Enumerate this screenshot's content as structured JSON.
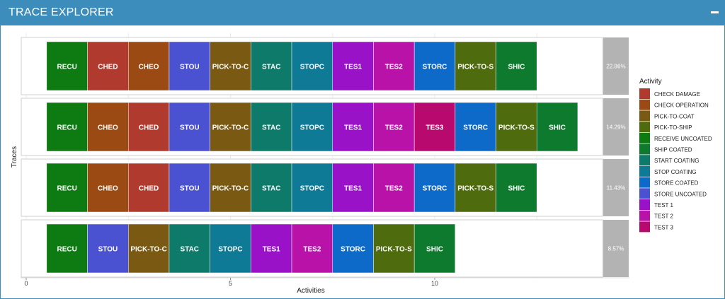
{
  "header": {
    "title": "TRACE EXPLORER",
    "collapse_icon": "minus-icon"
  },
  "chart_data": {
    "type": "trace-explorer",
    "xlabel": "Activities",
    "ylabel": "Traces",
    "x_ticks": [
      0,
      5,
      10
    ],
    "xlim": [
      0,
      14.5
    ],
    "legend_title": "Activity",
    "legend_position": "right",
    "activities": [
      {
        "name": "CHECK DAMAGE",
        "color": "#b03a2e"
      },
      {
        "name": "CHECK OPERATION",
        "color": "#9a4a12"
      },
      {
        "name": "PICK-TO-COAT",
        "color": "#7a5a12"
      },
      {
        "name": "PICK-TO-SHIP",
        "color": "#4e6c0e"
      },
      {
        "name": "RECEIVE UNCOATED",
        "color": "#0e7a12"
      },
      {
        "name": "SHIP COATED",
        "color": "#0e7a2e"
      },
      {
        "name": "START COATING",
        "color": "#0e7a6a"
      },
      {
        "name": "STOP COATING",
        "color": "#0e7a96"
      },
      {
        "name": "STORE COATED",
        "color": "#0e6ac8"
      },
      {
        "name": "STORE UNCOATED",
        "color": "#4a52d2"
      },
      {
        "name": "TEST 1",
        "color": "#9a12c8"
      },
      {
        "name": "TEST 2",
        "color": "#b812a8"
      },
      {
        "name": "TEST 3",
        "color": "#b80a6e"
      }
    ],
    "traces": [
      {
        "percent": "22.86%",
        "segments": [
          {
            "label": "RECU",
            "activity": "RECEIVE UNCOATED"
          },
          {
            "label": "CHED",
            "activity": "CHECK DAMAGE"
          },
          {
            "label": "CHEO",
            "activity": "CHECK OPERATION"
          },
          {
            "label": "STOU",
            "activity": "STORE UNCOATED"
          },
          {
            "label": "PICK-TO-C",
            "activity": "PICK-TO-COAT"
          },
          {
            "label": "STAC",
            "activity": "START COATING"
          },
          {
            "label": "STOPC",
            "activity": "STOP COATING"
          },
          {
            "label": "TES1",
            "activity": "TEST 1"
          },
          {
            "label": "TES2",
            "activity": "TEST 2"
          },
          {
            "label": "STORC",
            "activity": "STORE COATED"
          },
          {
            "label": "PICK-TO-S",
            "activity": "PICK-TO-SHIP"
          },
          {
            "label": "SHIC",
            "activity": "SHIP COATED"
          }
        ]
      },
      {
        "percent": "14.29%",
        "segments": [
          {
            "label": "RECU",
            "activity": "RECEIVE UNCOATED"
          },
          {
            "label": "CHEO",
            "activity": "CHECK OPERATION"
          },
          {
            "label": "CHED",
            "activity": "CHECK DAMAGE"
          },
          {
            "label": "STOU",
            "activity": "STORE UNCOATED"
          },
          {
            "label": "PICK-TO-C",
            "activity": "PICK-TO-COAT"
          },
          {
            "label": "STAC",
            "activity": "START COATING"
          },
          {
            "label": "STOPC",
            "activity": "STOP COATING"
          },
          {
            "label": "TES1",
            "activity": "TEST 1"
          },
          {
            "label": "TES2",
            "activity": "TEST 2"
          },
          {
            "label": "TES3",
            "activity": "TEST 3"
          },
          {
            "label": "STORC",
            "activity": "STORE COATED"
          },
          {
            "label": "PICK-TO-S",
            "activity": "PICK-TO-SHIP"
          },
          {
            "label": "SHIC",
            "activity": "SHIP COATED"
          }
        ]
      },
      {
        "percent": "11.43%",
        "segments": [
          {
            "label": "RECU",
            "activity": "RECEIVE UNCOATED"
          },
          {
            "label": "CHEO",
            "activity": "CHECK OPERATION"
          },
          {
            "label": "CHED",
            "activity": "CHECK DAMAGE"
          },
          {
            "label": "STOU",
            "activity": "STORE UNCOATED"
          },
          {
            "label": "PICK-TO-C",
            "activity": "PICK-TO-COAT"
          },
          {
            "label": "STAC",
            "activity": "START COATING"
          },
          {
            "label": "STOPC",
            "activity": "STOP COATING"
          },
          {
            "label": "TES1",
            "activity": "TEST 1"
          },
          {
            "label": "TES2",
            "activity": "TEST 2"
          },
          {
            "label": "STORC",
            "activity": "STORE COATED"
          },
          {
            "label": "PICK-TO-S",
            "activity": "PICK-TO-SHIP"
          },
          {
            "label": "SHIC",
            "activity": "SHIP COATED"
          }
        ]
      },
      {
        "percent": "8.57%",
        "segments": [
          {
            "label": "RECU",
            "activity": "RECEIVE UNCOATED"
          },
          {
            "label": "STOU",
            "activity": "STORE UNCOATED"
          },
          {
            "label": "PICK-TO-C",
            "activity": "PICK-TO-COAT"
          },
          {
            "label": "STAC",
            "activity": "START COATING"
          },
          {
            "label": "STOPC",
            "activity": "STOP COATING"
          },
          {
            "label": "TES1",
            "activity": "TEST 1"
          },
          {
            "label": "TES2",
            "activity": "TEST 2"
          },
          {
            "label": "STORC",
            "activity": "STORE COATED"
          },
          {
            "label": "PICK-TO-S",
            "activity": "PICK-TO-SHIP"
          },
          {
            "label": "SHIC",
            "activity": "SHIP COATED"
          }
        ]
      }
    ]
  }
}
